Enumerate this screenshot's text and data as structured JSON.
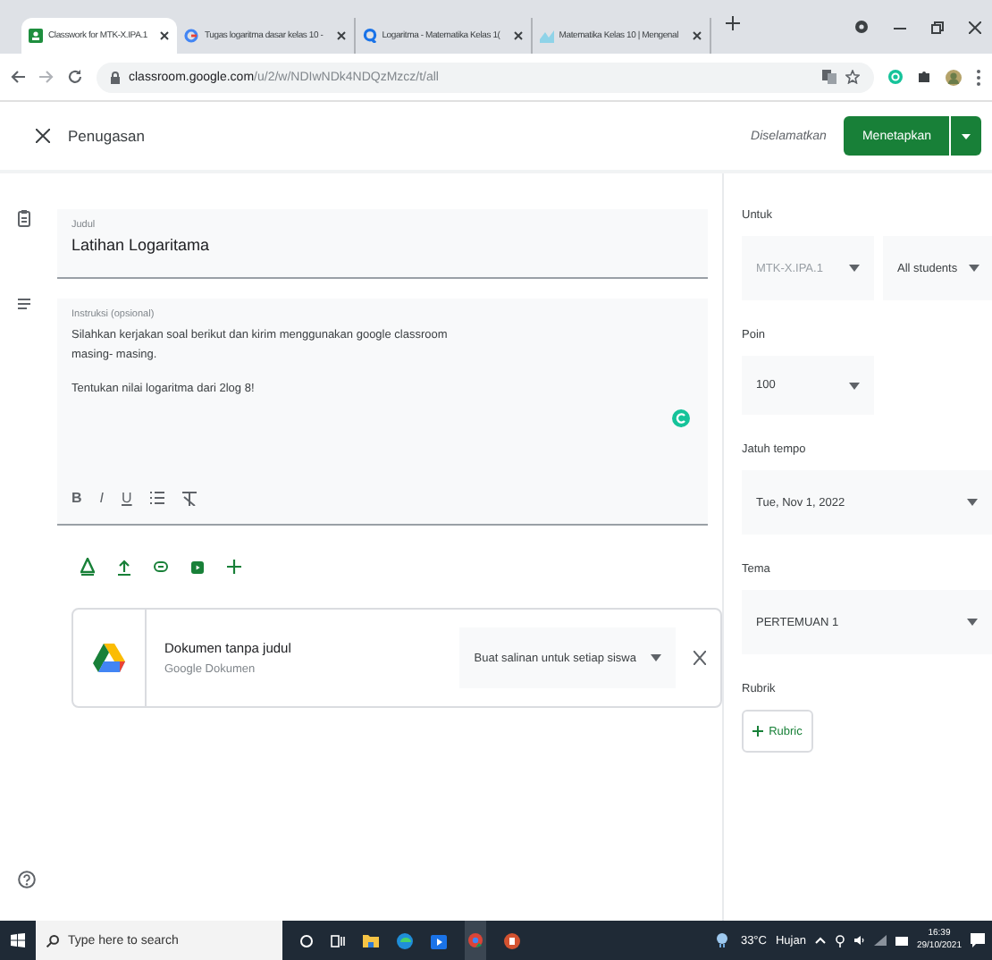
{
  "browser": {
    "tabs": [
      {
        "title": "Classwork for MTK-X.IPA.1",
        "kind": "board",
        "selected": true
      },
      {
        "title": "Tugas logaritma dasar kelas 10 -",
        "kind": "ring",
        "selected": false
      },
      {
        "title": "Logaritma - Matematika Kelas 1(",
        "kind": "lens",
        "selected": false
      },
      {
        "title": "Matematika Kelas 10 | Mengenal",
        "kind": "site",
        "selected": false
      }
    ],
    "url_host": "classroom.google.com",
    "url_path": "/u/2/w/NDIwNDk4NDQzMzcz/t/all"
  },
  "header": {
    "title": "Penugasan",
    "save_status": "Diselamatkan",
    "assign_button": "Menetapkan"
  },
  "title_field": {
    "label": "Judul",
    "value": "Latihan Logaritama"
  },
  "instructions": {
    "label": "Instruksi (opsional)",
    "paragraphs": [
      [
        "Silahkan kerjakan soal berikut dan kirim menggunakan google classroom",
        "masing- masing."
      ],
      [
        "Tentukan nilai logaritma dari 2log 8!"
      ]
    ],
    "format_buttons": [
      {
        "text": "B",
        "kind": "bold"
      },
      {
        "text": "I",
        "kind": "italic"
      },
      {
        "text": "U",
        "kind": "underline"
      }
    ]
  },
  "attachment": {
    "title": "Dokumen tanpa judul",
    "type": "Google Dokumen",
    "share_mode": "Buat salinan untuk setiap siswa"
  },
  "side": {
    "for_label": "Untuk",
    "class_select": {
      "value": "MTK-X.IPA.1",
      "disabled": true
    },
    "students_select": {
      "value": "All students",
      "disabled": false
    },
    "points_label": "Poin",
    "points": "100",
    "due_label": "Jatuh tempo",
    "due": "Tue, Nov 1, 2022",
    "topic_label": "Tema",
    "topic": "PERTEMUAN 1",
    "rubric_label": "Rubrik",
    "rubric_button": "Rubric"
  },
  "taskbar": {
    "search_placeholder": "Type here to search",
    "temperature": "33°C",
    "condition": "Hujan",
    "time": "16:39",
    "date": "29/10/2021"
  }
}
